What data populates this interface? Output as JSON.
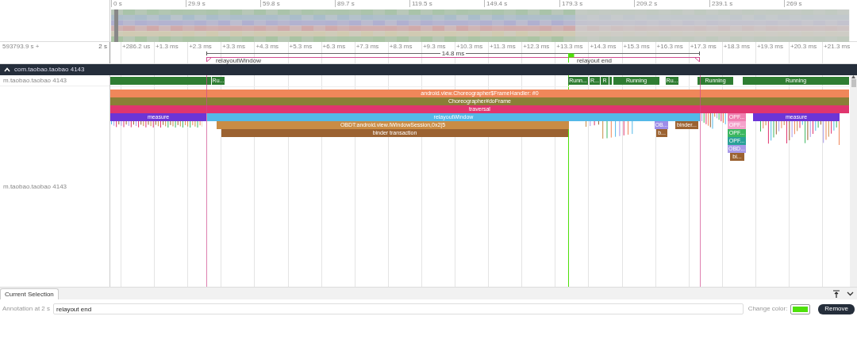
{
  "overview_ruler": {
    "ticks": [
      "0 s",
      "29.9 s",
      "59.8 s",
      "89.7 s",
      "119.5 s",
      "149.4 s",
      "179.3 s",
      "209.2 s",
      "239.1 s",
      "269 s"
    ]
  },
  "time_ruler": {
    "offset": "593793.9 s +",
    "scale": "2 s",
    "ticks": [
      "+286.2 us",
      "+1.3 ms",
      "+2.3 ms",
      "+3.3 ms",
      "+4.3 ms",
      "+5.3 ms",
      "+6.3 ms",
      "+7.3 ms",
      "+8.3 ms",
      "+9.3 ms",
      "+10.3 ms",
      "+11.3 ms",
      "+12.3 ms",
      "+13.3 ms",
      "+14.3 ms",
      "+15.3 ms",
      "+16.3 ms",
      "+17.3 ms",
      "+18.3 ms",
      "+19.3 ms",
      "+20.3 ms",
      "+21.3 ms"
    ]
  },
  "markers": {
    "span_label": "14.8 ms",
    "notes": [
      {
        "kind": "span_start",
        "label": "relayoutWindow"
      },
      {
        "kind": "flag",
        "label": "relayout end",
        "color": "#4ee00a"
      },
      {
        "kind": "span_end"
      }
    ]
  },
  "process": {
    "name": "com.taobao.taobao 4143",
    "expanded": true
  },
  "thread": {
    "label": "m.taobao.taobao 4143",
    "states": [
      {
        "kind": "running"
      },
      {
        "kind": "running",
        "label": "Ru..."
      },
      {
        "kind": "running",
        "label": "Runn..."
      },
      {
        "kind": "running",
        "label": "R..."
      },
      {
        "kind": "running",
        "label": "R"
      },
      {
        "kind": "running"
      },
      {
        "kind": "running",
        "label": "Running"
      },
      {
        "kind": "running",
        "label": "Ru..."
      },
      {
        "kind": "running",
        "label": "Running"
      },
      {
        "kind": "running",
        "label": "Running"
      }
    ]
  },
  "slices": [
    {
      "label": "android.view.Choreographer$FrameHandler: #0",
      "color": "#f0875a"
    },
    {
      "label": "Choreographer#doFrame",
      "color": "#8a7f37"
    },
    {
      "label": "traversal",
      "color": "#e0356e"
    },
    {
      "label": "measure",
      "color": "#6c35d6"
    },
    {
      "label": "relayoutWindow",
      "color": "#53b8e8"
    },
    {
      "label": "OPF...",
      "color": "#f07fb0"
    },
    {
      "label": "measure",
      "color": "#6c35d6"
    },
    {
      "label": "OBDT:android.view.IWindowSession,0x2|5",
      "color": "#c98c45"
    },
    {
      "label": "OB...",
      "color": "#9d8de8"
    },
    {
      "label": "binder...",
      "color": "#9b6231"
    },
    {
      "label": "OPF...",
      "color": "#f5a3cc"
    },
    {
      "label": "binder transaction",
      "color": "#9b6231"
    },
    {
      "label": "b...",
      "color": "#9b6231"
    },
    {
      "label": "OPF...",
      "color": "#3cb760"
    },
    {
      "label": "OPF...",
      "color": "#2aa198"
    },
    {
      "label": "OBD...",
      "color": "#a99be8"
    },
    {
      "label": "bi...",
      "color": "#9b6231"
    }
  ],
  "slice_track_label": "m.taobao.taobao 4143",
  "bottom_panel": {
    "tabs": [
      {
        "label": "Current Selection",
        "selected": true
      }
    ],
    "annotation_label": "Annotation at 2 s",
    "annotation_value": "relayout end",
    "change_color_label": "Change color:",
    "color": "#4ee00a",
    "remove_button": "Remove"
  }
}
